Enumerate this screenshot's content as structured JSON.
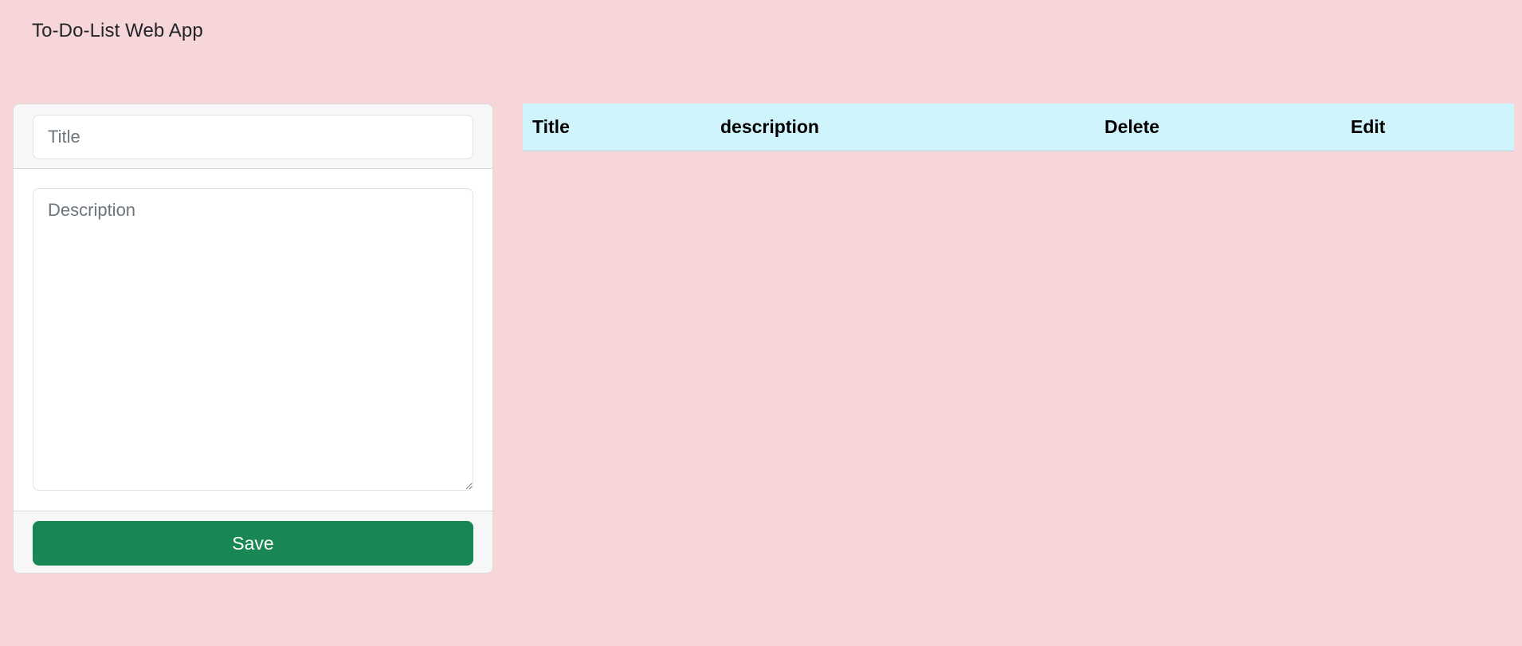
{
  "navbar": {
    "brand": "To-Do-List Web App"
  },
  "form": {
    "title_placeholder": "Title",
    "title_value": "",
    "description_placeholder": "Description",
    "description_value": "",
    "save_label": "Save"
  },
  "table": {
    "headers": [
      "Title",
      "description",
      "Delete",
      "Edit"
    ],
    "rows": []
  },
  "colors": {
    "page_background": "#f7d6da",
    "table_header_background": "#cff4fc",
    "save_button": "#198754"
  }
}
